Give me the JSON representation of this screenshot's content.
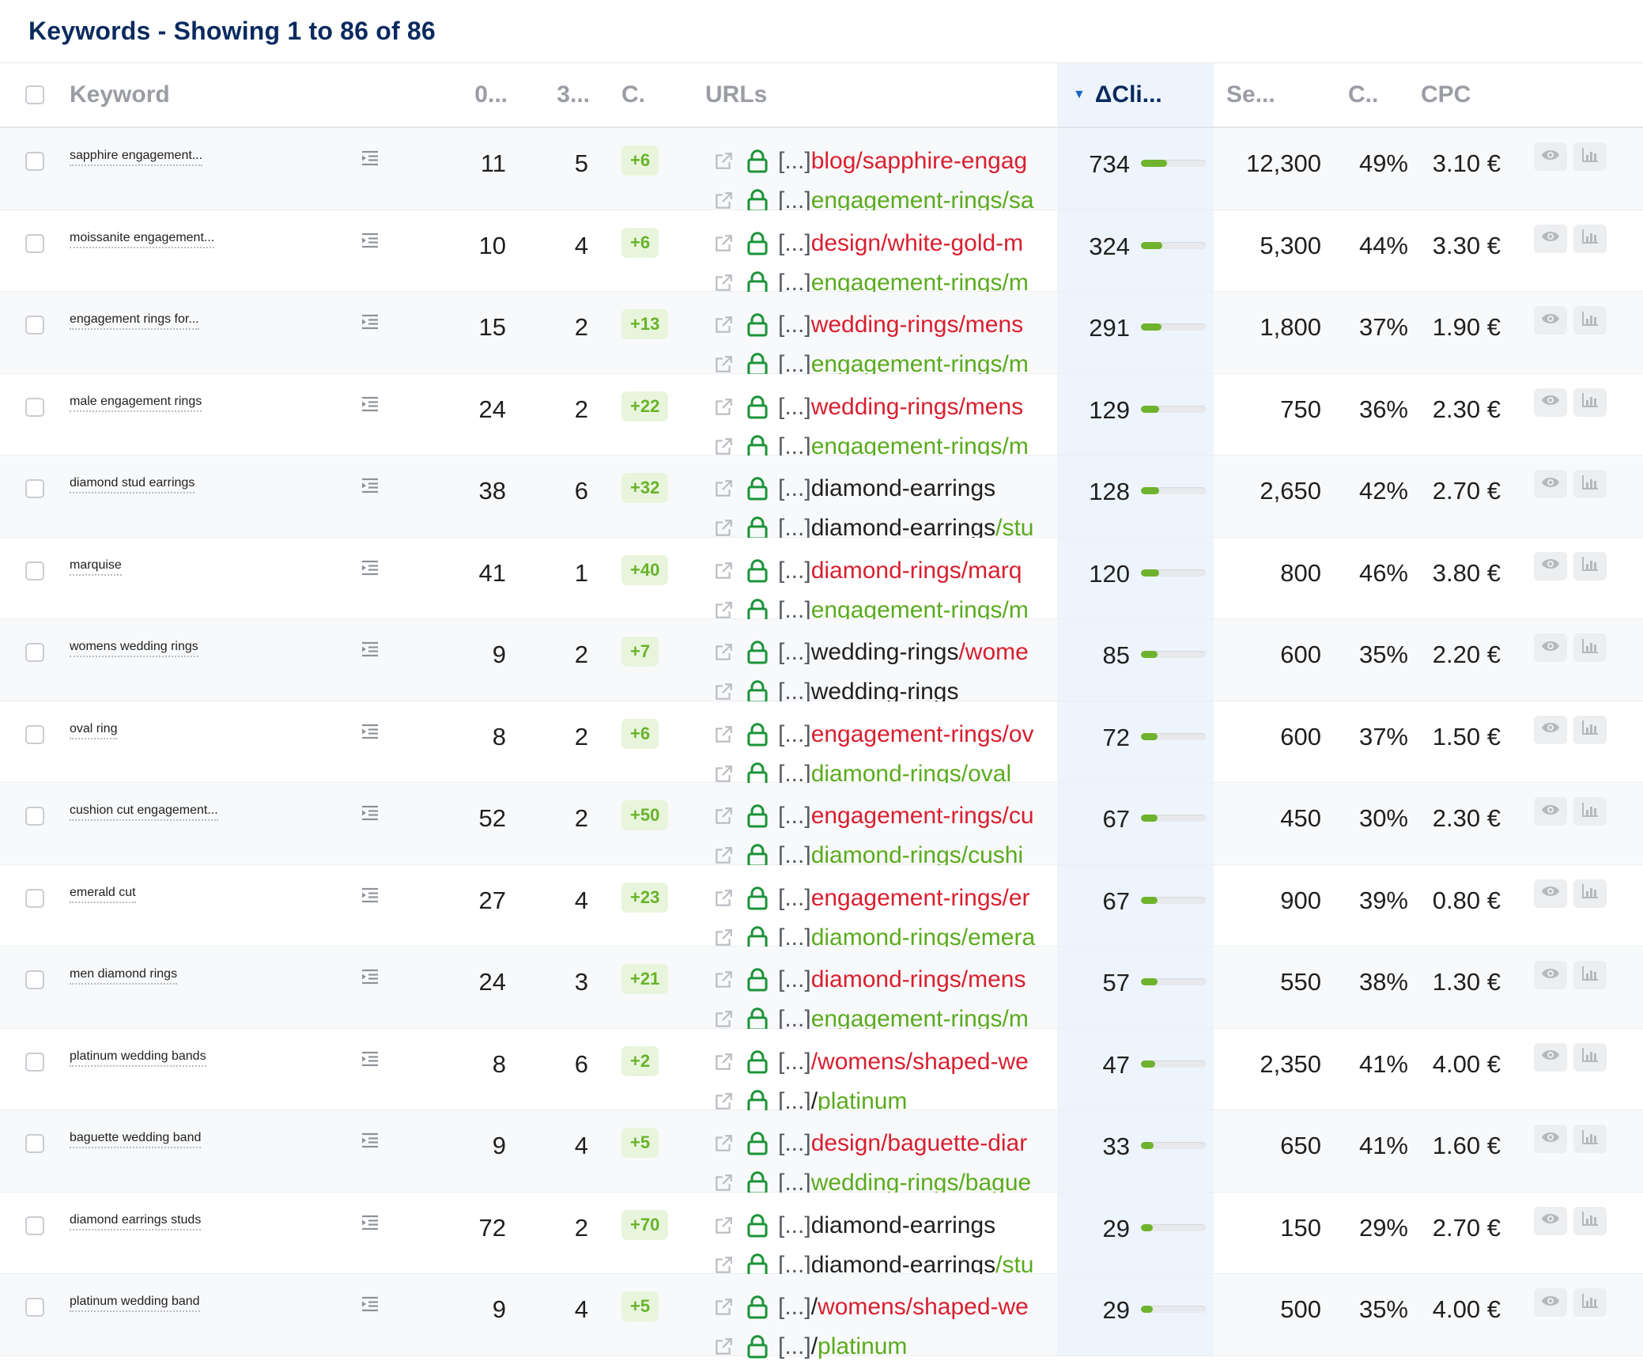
{
  "title": "Keywords - Showing 1 to 86 of 86",
  "columns": {
    "keyword": "Keyword",
    "col_o": "0...",
    "col_3": "3...",
    "col_c": "C.",
    "urls": "URLs",
    "delta_clicks": "ΔCli...",
    "search": "Se...",
    "comp": "C..",
    "cpc": "CPC"
  },
  "colors": {
    "red": "#d81f2f",
    "green": "#5aab1e",
    "accent": "#0a2a5e",
    "chip_bg": "#e8f5dc",
    "chip_text": "#69b32a"
  },
  "icons": {
    "serp": "serp-features-icon",
    "external": "external-link-icon",
    "lock": "lock-icon",
    "eye": "eye-icon",
    "chart": "chart-icon",
    "sort": "sort-desc-icon"
  },
  "url_prefix": "[...]",
  "rows": [
    {
      "keyword": "sapphire engagement...",
      "pos_a": "11",
      "pos_b": "5",
      "change": "+6",
      "url1": [
        {
          "t": "blog/sapphire-engag",
          "c": "red"
        }
      ],
      "url2": [
        {
          "t": "engagement-rings/sa",
          "c": "green"
        }
      ],
      "clicks": "734",
      "clicks_pct": 0.4,
      "search": "12,300",
      "comp": "49%",
      "cpc": "3.10 €"
    },
    {
      "keyword": "moissanite engagement...",
      "pos_a": "10",
      "pos_b": "4",
      "change": "+6",
      "url1": [
        {
          "t": "design/white-gold-m",
          "c": "red"
        }
      ],
      "url2": [
        {
          "t": "engagement-rings/m",
          "c": "green"
        }
      ],
      "clicks": "324",
      "clicks_pct": 0.33,
      "search": "5,300",
      "comp": "44%",
      "cpc": "3.30 €"
    },
    {
      "keyword": "engagement rings for...",
      "pos_a": "15",
      "pos_b": "2",
      "change": "+13",
      "url1": [
        {
          "t": "wedding-rings/mens",
          "c": "red"
        }
      ],
      "url2": [
        {
          "t": "engagement-rings/m",
          "c": "green"
        }
      ],
      "clicks": "291",
      "clicks_pct": 0.32,
      "search": "1,800",
      "comp": "37%",
      "cpc": "1.90 €"
    },
    {
      "keyword": "male engagement rings",
      "pos_a": "24",
      "pos_b": "2",
      "change": "+22",
      "url1": [
        {
          "t": "wedding-rings/mens",
          "c": "red"
        }
      ],
      "url2": [
        {
          "t": "engagement-rings/m",
          "c": "green"
        }
      ],
      "clicks": "129",
      "clicks_pct": 0.28,
      "search": "750",
      "comp": "36%",
      "cpc": "2.30 €"
    },
    {
      "keyword": "diamond stud earrings",
      "pos_a": "38",
      "pos_b": "6",
      "change": "+32",
      "url1": [
        {
          "t": "diamond-earrings",
          "c": "dark"
        }
      ],
      "url2": [
        {
          "t": "diamond-earrings",
          "c": "dark"
        },
        {
          "t": "/stu",
          "c": "green"
        }
      ],
      "clicks": "128",
      "clicks_pct": 0.28,
      "search": "2,650",
      "comp": "42%",
      "cpc": "2.70 €"
    },
    {
      "keyword": "marquise",
      "pos_a": "41",
      "pos_b": "1",
      "change": "+40",
      "url1": [
        {
          "t": "diamond-rings/marq",
          "c": "red"
        }
      ],
      "url2": [
        {
          "t": "engagement-rings/m",
          "c": "green"
        }
      ],
      "clicks": "120",
      "clicks_pct": 0.28,
      "search": "800",
      "comp": "46%",
      "cpc": "3.80 €"
    },
    {
      "keyword": "womens wedding rings",
      "pos_a": "9",
      "pos_b": "2",
      "change": "+7",
      "url1": [
        {
          "t": "wedding-rings",
          "c": "dark"
        },
        {
          "t": "/wome",
          "c": "red"
        }
      ],
      "url2": [
        {
          "t": "wedding-rings",
          "c": "dark"
        }
      ],
      "clicks": "85",
      "clicks_pct": 0.26,
      "search": "600",
      "comp": "35%",
      "cpc": "2.20 €"
    },
    {
      "keyword": "oval ring",
      "pos_a": "8",
      "pos_b": "2",
      "change": "+6",
      "url1": [
        {
          "t": "engagement-rings/ov",
          "c": "red"
        }
      ],
      "url2": [
        {
          "t": "diamond-rings/oval",
          "c": "green"
        }
      ],
      "clicks": "72",
      "clicks_pct": 0.26,
      "search": "600",
      "comp": "37%",
      "cpc": "1.50 €"
    },
    {
      "keyword": "cushion cut engagement...",
      "pos_a": "52",
      "pos_b": "2",
      "change": "+50",
      "url1": [
        {
          "t": "engagement-rings/cu",
          "c": "red"
        }
      ],
      "url2": [
        {
          "t": "diamond-rings/cushi",
          "c": "green"
        }
      ],
      "clicks": "67",
      "clicks_pct": 0.26,
      "search": "450",
      "comp": "30%",
      "cpc": "2.30 €"
    },
    {
      "keyword": "emerald cut",
      "pos_a": "27",
      "pos_b": "4",
      "change": "+23",
      "url1": [
        {
          "t": "engagement-rings/er",
          "c": "red"
        }
      ],
      "url2": [
        {
          "t": "diamond-rings/emera",
          "c": "green"
        }
      ],
      "clicks": "67",
      "clicks_pct": 0.26,
      "search": "900",
      "comp": "39%",
      "cpc": "0.80 €"
    },
    {
      "keyword": "men diamond rings",
      "pos_a": "24",
      "pos_b": "3",
      "change": "+21",
      "url1": [
        {
          "t": "diamond-rings/mens",
          "c": "red"
        }
      ],
      "url2": [
        {
          "t": "engagement-rings/m",
          "c": "green"
        }
      ],
      "clicks": "57",
      "clicks_pct": 0.25,
      "search": "550",
      "comp": "38%",
      "cpc": "1.30 €"
    },
    {
      "keyword": "platinum wedding bands",
      "pos_a": "8",
      "pos_b": "6",
      "change": "+2",
      "url1": [
        {
          "t": "/womens/shaped-we",
          "c": "red"
        }
      ],
      "url2": [
        {
          "t": "/",
          "c": "dark"
        },
        {
          "t": "platinum",
          "c": "green"
        }
      ],
      "clicks": "47",
      "clicks_pct": 0.22,
      "search": "2,350",
      "comp": "41%",
      "cpc": "4.00 €"
    },
    {
      "keyword": "baguette wedding band",
      "pos_a": "9",
      "pos_b": "4",
      "change": "+5",
      "url1": [
        {
          "t": "design/baguette-diar",
          "c": "red"
        }
      ],
      "url2": [
        {
          "t": "wedding-rings/bague",
          "c": "green"
        }
      ],
      "clicks": "33",
      "clicks_pct": 0.2,
      "search": "650",
      "comp": "41%",
      "cpc": "1.60 €"
    },
    {
      "keyword": "diamond earrings studs",
      "pos_a": "72",
      "pos_b": "2",
      "change": "+70",
      "url1": [
        {
          "t": "diamond-earrings",
          "c": "dark"
        }
      ],
      "url2": [
        {
          "t": "diamond-earrings",
          "c": "dark"
        },
        {
          "t": "/stu",
          "c": "green"
        }
      ],
      "clicks": "29",
      "clicks_pct": 0.18,
      "search": "150",
      "comp": "29%",
      "cpc": "2.70 €"
    },
    {
      "keyword": "platinum wedding band",
      "pos_a": "9",
      "pos_b": "4",
      "change": "+5",
      "url1": [
        {
          "t": "/",
          "c": "dark"
        },
        {
          "t": "womens/shaped-we",
          "c": "red"
        }
      ],
      "url2": [
        {
          "t": "/",
          "c": "dark"
        },
        {
          "t": "platinum",
          "c": "green"
        }
      ],
      "clicks": "29",
      "clicks_pct": 0.18,
      "search": "500",
      "comp": "35%",
      "cpc": "4.00 €"
    }
  ]
}
